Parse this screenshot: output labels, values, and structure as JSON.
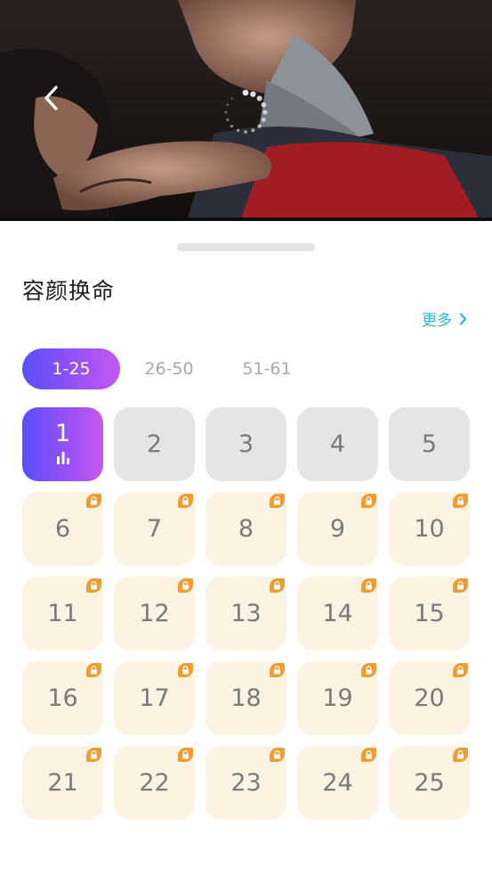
{
  "player": {
    "back_icon": "chevron-left-icon",
    "loading_icon": "loading-spinner-icon"
  },
  "drama": {
    "title": "容颜换命",
    "more_label": "更多",
    "more_icon": "chevron-right-icon"
  },
  "range_tabs": [
    {
      "label": "1-25",
      "active": true
    },
    {
      "label": "26-50",
      "active": false
    },
    {
      "label": "51-61",
      "active": false
    }
  ],
  "episodes": [
    {
      "label": "1",
      "state": "current"
    },
    {
      "label": "2",
      "state": "free"
    },
    {
      "label": "3",
      "state": "free"
    },
    {
      "label": "4",
      "state": "free"
    },
    {
      "label": "5",
      "state": "free"
    },
    {
      "label": "6",
      "state": "locked"
    },
    {
      "label": "7",
      "state": "locked"
    },
    {
      "label": "8",
      "state": "locked"
    },
    {
      "label": "9",
      "state": "locked"
    },
    {
      "label": "10",
      "state": "locked"
    },
    {
      "label": "11",
      "state": "locked"
    },
    {
      "label": "12",
      "state": "locked"
    },
    {
      "label": "13",
      "state": "locked"
    },
    {
      "label": "14",
      "state": "locked"
    },
    {
      "label": "15",
      "state": "locked"
    },
    {
      "label": "16",
      "state": "locked"
    },
    {
      "label": "17",
      "state": "locked"
    },
    {
      "label": "18",
      "state": "locked"
    },
    {
      "label": "19",
      "state": "locked"
    },
    {
      "label": "20",
      "state": "locked"
    },
    {
      "label": "21",
      "state": "locked"
    },
    {
      "label": "22",
      "state": "locked"
    },
    {
      "label": "23",
      "state": "locked"
    },
    {
      "label": "24",
      "state": "locked"
    },
    {
      "label": "25",
      "state": "locked"
    }
  ],
  "colors": {
    "accent_gradient_start": "#5b4dfb",
    "accent_gradient_end": "#c657f2",
    "more_link": "#29b7e6",
    "free_tile": "#e5e5e5",
    "locked_tile": "#fdf3e2",
    "lock_badge": "#f39b2d"
  }
}
